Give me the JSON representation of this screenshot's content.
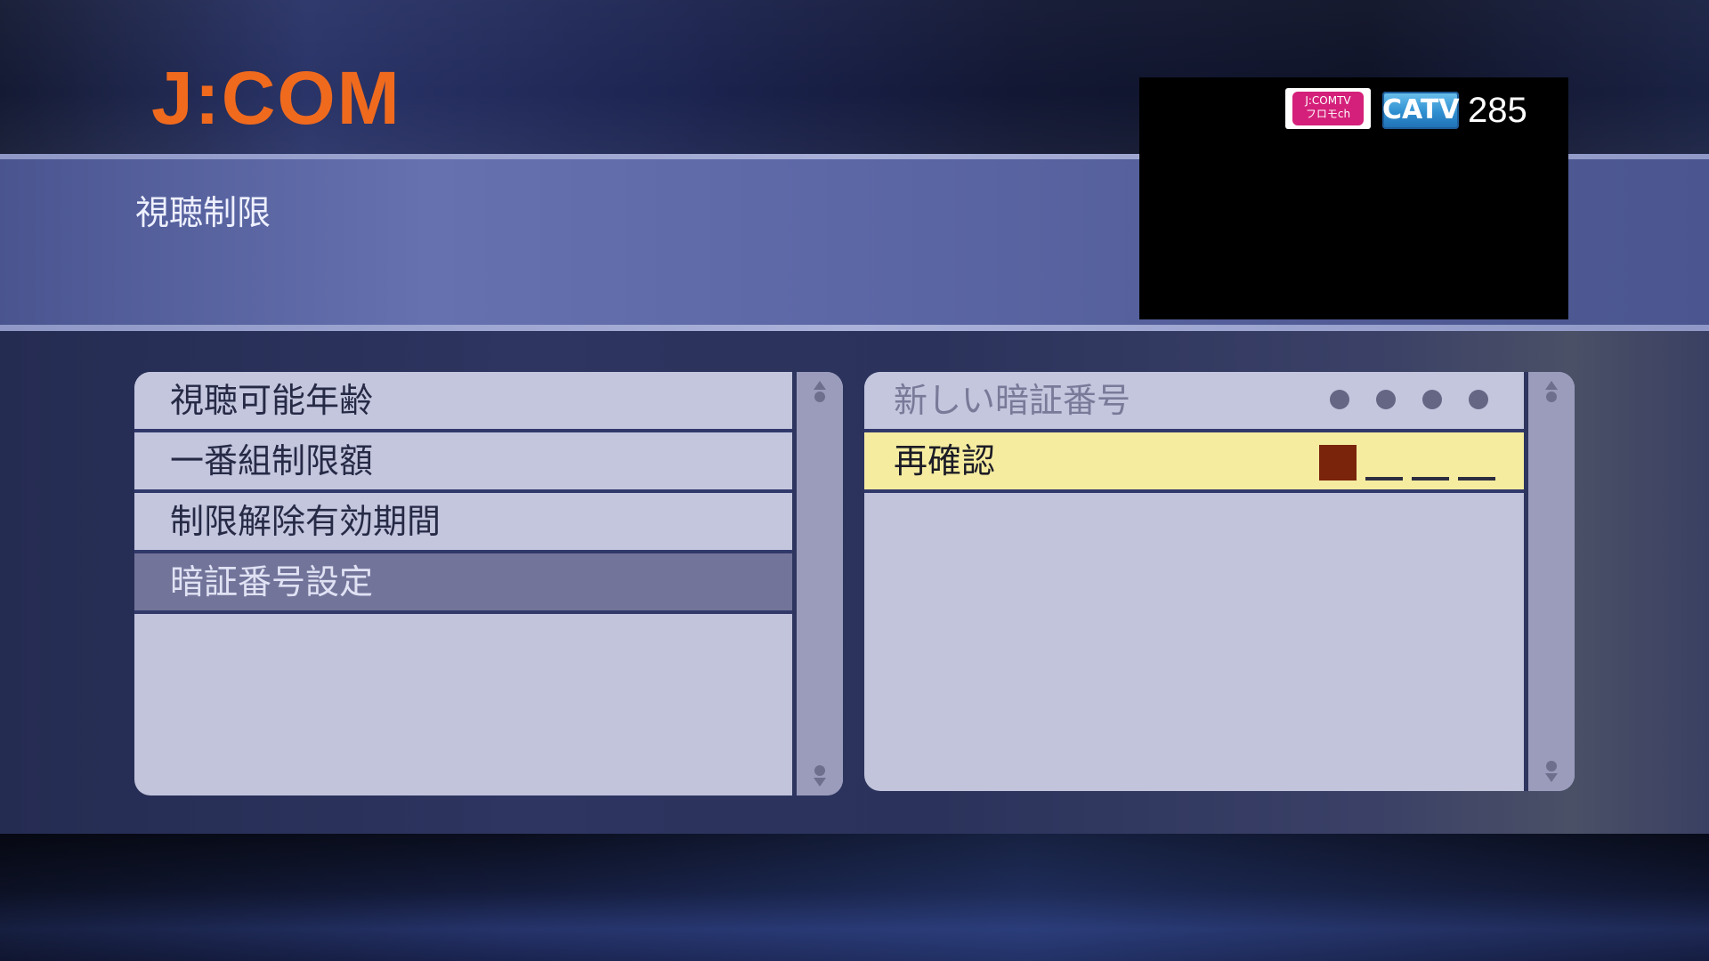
{
  "brand": {
    "logo_text": "J:COM",
    "logo_color": "#f06a1e"
  },
  "page": {
    "title": "視聴制限"
  },
  "preview": {
    "channel_logo_text": "J:COMTV\nフロモch",
    "network_badge": "CATV",
    "channel_number": "285"
  },
  "menu": {
    "items": [
      {
        "label": "視聴可能年齢",
        "selected": false
      },
      {
        "label": "一番組制限額",
        "selected": false
      },
      {
        "label": "制限解除有効期間",
        "selected": false
      },
      {
        "label": "暗証番号設定",
        "selected": true
      }
    ]
  },
  "pin": {
    "new_pin_label": "新しい暗証番号",
    "new_pin_entered_digits": 4,
    "confirm_label": "再確認",
    "confirm_entered_digits": 0,
    "pin_length": 4
  },
  "colors": {
    "accent_highlight": "#f5eca0",
    "selected_item_bg": "#72749a",
    "panel_bg": "#c2c4dc",
    "cursor": "#7a240c"
  },
  "icons": {
    "scroll_up": "scroll-up-arrow-icon",
    "scroll_down": "scroll-down-arrow-icon"
  }
}
